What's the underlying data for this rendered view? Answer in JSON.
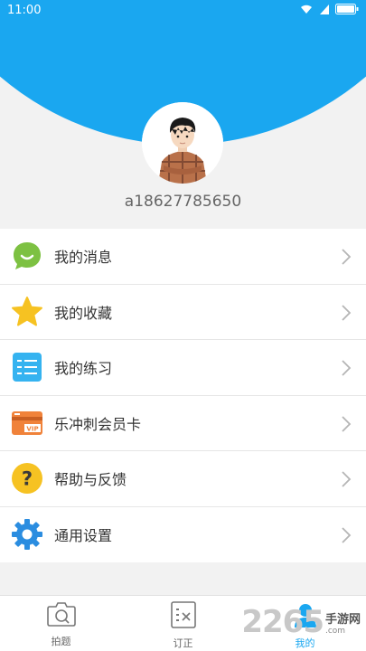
{
  "status_bar": {
    "time": "11:00"
  },
  "profile": {
    "username": "a18627785650"
  },
  "menu": [
    {
      "label": "我的消息",
      "icon": "message-icon",
      "color": "#7dc142"
    },
    {
      "label": "我的收藏",
      "icon": "star-icon",
      "color": "#f6c222"
    },
    {
      "label": "我的练习",
      "icon": "practice-icon",
      "color": "#35b3f0"
    },
    {
      "label": "乐冲刺会员卡",
      "icon": "vip-card-icon",
      "color": "#f0823a",
      "badge": "VIP"
    },
    {
      "label": "帮助与反馈",
      "icon": "help-icon",
      "color": "#f6c222",
      "glyph": "?"
    },
    {
      "label": "通用设置",
      "icon": "gear-icon",
      "color": "#2b8de0"
    }
  ],
  "tabbar": {
    "tabs": [
      {
        "label": "拍题",
        "icon": "camera-icon"
      },
      {
        "label": "订正",
        "icon": "correction-icon"
      },
      {
        "label": "我的",
        "icon": "profile-icon",
        "active": true
      }
    ]
  },
  "watermark": {
    "number": "2265",
    "cn": "手游网",
    "en": ".com"
  },
  "colors": {
    "accent": "#1aa7f0",
    "background": "#f2f2f2"
  }
}
